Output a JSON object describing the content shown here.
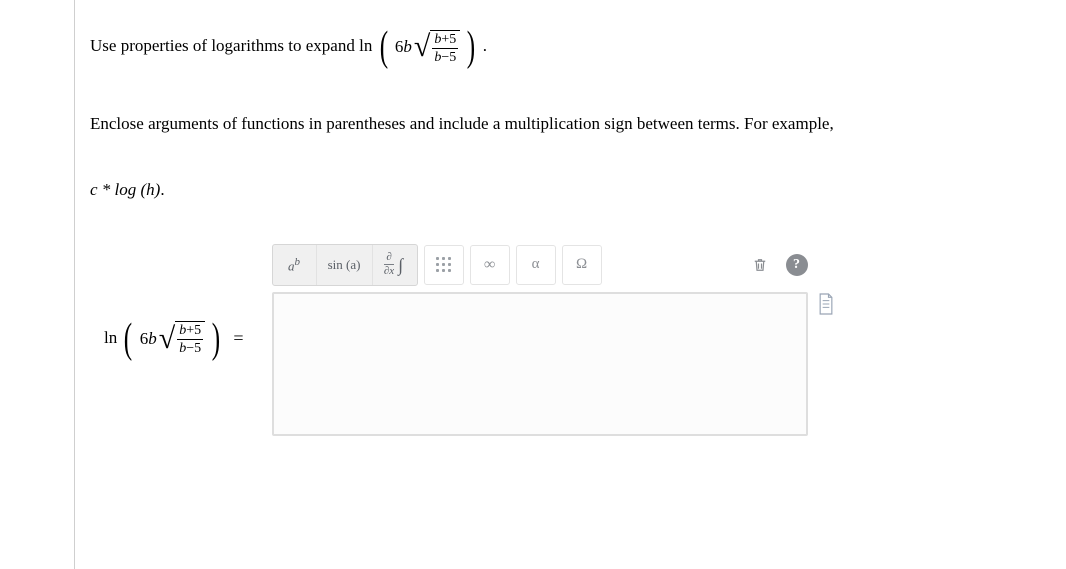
{
  "question": {
    "prompt_prefix": "Use properties of logarithms to expand ",
    "note": "Enclose arguments of functions in parentheses and include a multiplication sign between terms. For example, ",
    "example": "c * log (h)",
    "period": "."
  },
  "expression": {
    "fn": "ln",
    "coef": "6",
    "var": "b",
    "frac_num_lhs": "b",
    "frac_num_op": "+",
    "frac_num_rhs": "5",
    "frac_den_lhs": "b",
    "frac_den_op": "−",
    "frac_den_rhs": "5",
    "equals": "="
  },
  "toolbar": {
    "power": {
      "base": "a",
      "exp": "b"
    },
    "trig": "sin (a)",
    "partial": {
      "top": "∂",
      "bottom": "∂x",
      "int": "∫"
    },
    "infinity": "∞",
    "alpha": "α",
    "omega": "Ω"
  },
  "icons": {
    "keypad": "keypad-icon",
    "trash": "trash-icon",
    "help": "?",
    "sheet": "example-sheet-icon"
  }
}
